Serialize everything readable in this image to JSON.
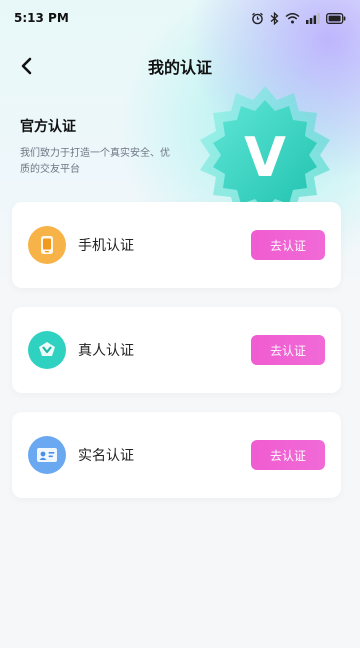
{
  "status_bar": {
    "time": "5:13 PM"
  },
  "nav": {
    "title": "我的认证",
    "back_icon": "chevron-left-icon"
  },
  "intro": {
    "title": "官方认证",
    "description": "我们致力于打造一个真实安全、优质的交友平台"
  },
  "badge": {
    "letter": "V"
  },
  "items": [
    {
      "label": "手机认证",
      "button": "去认证",
      "icon": "phone-icon",
      "color": "#f5a623"
    },
    {
      "label": "真人认证",
      "button": "去认证",
      "icon": "face-verify-icon",
      "color": "#2fd1c0"
    },
    {
      "label": "实名认证",
      "button": "去认证",
      "icon": "id-card-icon",
      "color": "#5b9df0"
    }
  ],
  "colors": {
    "accent": "#f05cd1",
    "teal": "#2fd1c0"
  }
}
